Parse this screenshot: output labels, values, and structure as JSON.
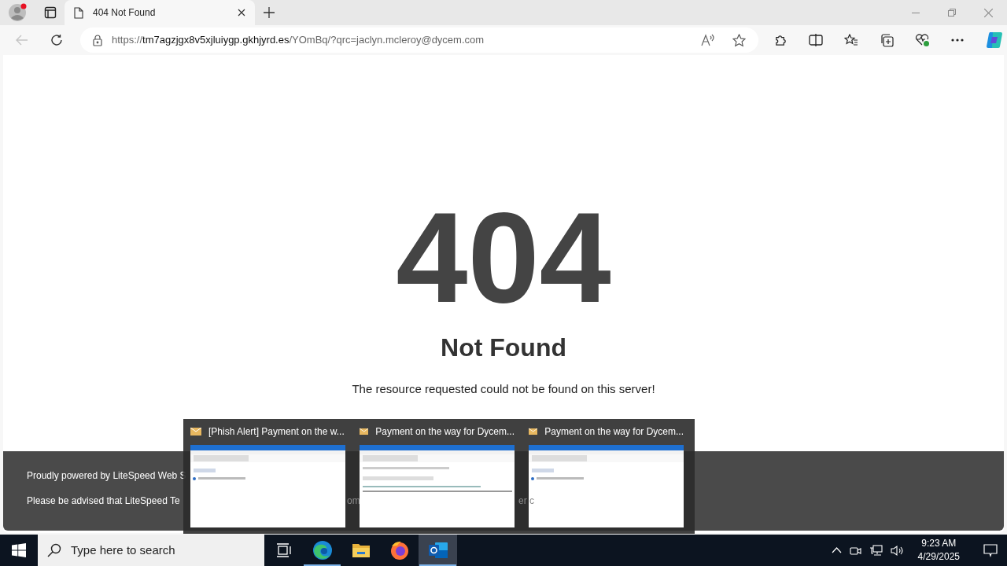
{
  "browser": {
    "tab": {
      "title": "404 Not Found"
    },
    "address": {
      "scheme": "https://",
      "host": "tm7agzjgx8v5xjluiygp.gkhjyrd.es",
      "path": "/YOmBq/?qrc=jaclyn.mcleroy@dycem.com"
    }
  },
  "page": {
    "code": "404",
    "heading": "Not Found",
    "message": "The resource requested could not be found on this server!",
    "footer_lines": [
      "Proudly powered by LiteSpeed Web S",
      "Please be advised that LiteSpeed Te"
    ],
    "footer_fragments": [
      "om",
      "er c"
    ]
  },
  "previews": [
    {
      "title": "[Phish Alert] Payment on the w...",
      "kind": "list"
    },
    {
      "title": "Payment on the way for Dycem...",
      "kind": "message"
    },
    {
      "title": "Payment on the way for Dycem...",
      "kind": "list"
    }
  ],
  "taskbar": {
    "search_placeholder": "Type here to search",
    "apps": [
      {
        "kind": "taskview",
        "running": false,
        "selected": false
      },
      {
        "kind": "edge",
        "running": true,
        "selected": false
      },
      {
        "kind": "explorer",
        "running": false,
        "selected": false
      },
      {
        "kind": "firefox",
        "running": false,
        "selected": false
      },
      {
        "kind": "outlook",
        "running": true,
        "selected": true
      }
    ],
    "time": "9:23 AM",
    "date": "4/29/2025"
  }
}
